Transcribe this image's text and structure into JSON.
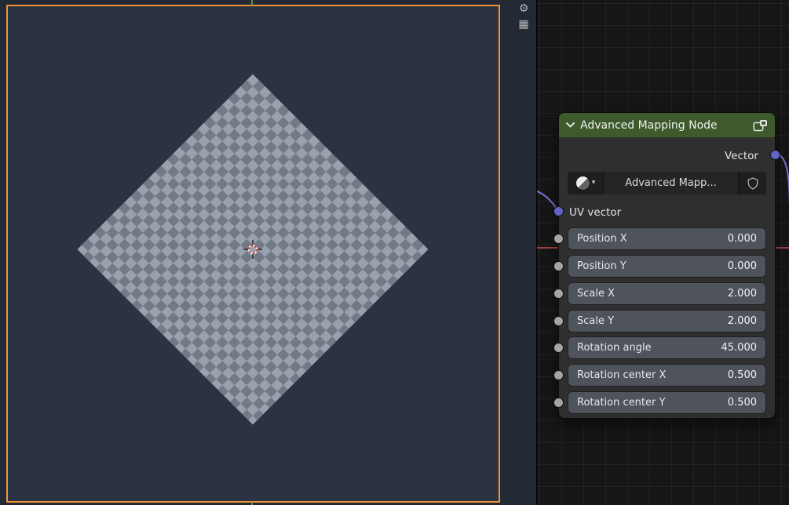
{
  "css_vars": {
    "--viewport-bg": "#232a35",
    "--plane-bg": "#2b3342",
    "--outline-orange": "#ee9434",
    "--checker-light": "#99a1ad",
    "--checker-dark": "#727a87",
    "--axis-green": "#5f8f3e",
    "--axis-red": "#9e4343",
    "--editor-bg": "#161616",
    "--grid-line": "rgba(255,255,255,0.05)",
    "--node-body": "#2f2f2f",
    "--node-header": "#3e5a2d",
    "--field-bg": "#4e535c",
    "--socket-vector": "#6463c7",
    "--socket-value": "#a5a5a5",
    "--noodle": "#7574d8",
    "--text-light": "#e2e4e8"
  },
  "icons": {
    "gear": "⚙",
    "grid": "▦",
    "dropdown": "▾",
    "collapse_chevron": "chevron-down",
    "node_group": "node-group",
    "preview_sphere": "material-sphere",
    "shield": "fake-user-shield",
    "cursor": "3d-cursor"
  },
  "node": {
    "title": "Advanced Mapping Node",
    "output_label": "Vector",
    "group_name": "Advanced Mapp...",
    "input_label": "UV vector",
    "fields": [
      {
        "label": "Position X",
        "value": "0.000"
      },
      {
        "label": "Position Y",
        "value": "0.000"
      },
      {
        "label": "Scale X",
        "value": "2.000"
      },
      {
        "label": "Scale Y",
        "value": "2.000"
      },
      {
        "label": "Rotation angle",
        "value": "45.000"
      },
      {
        "label": "Rotation center X",
        "value": "0.500"
      },
      {
        "label": "Rotation center Y",
        "value": "0.500"
      }
    ]
  }
}
